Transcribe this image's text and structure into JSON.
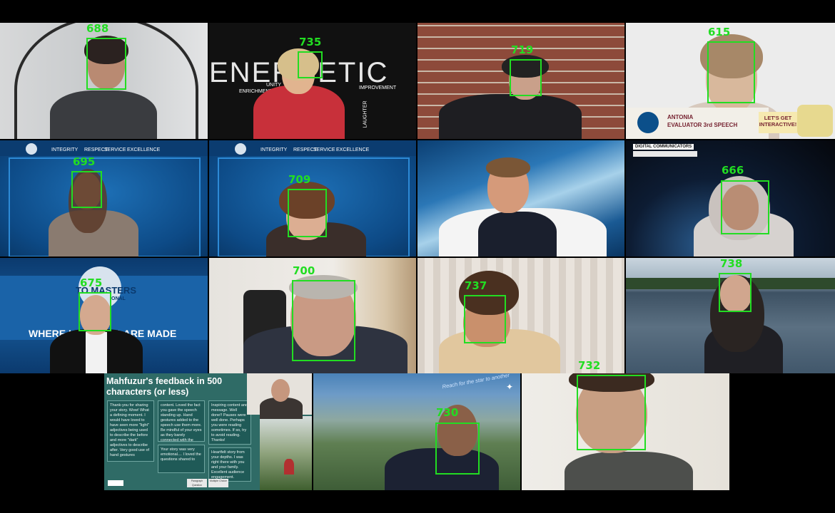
{
  "faces": [
    {
      "id": "688",
      "label": "688"
    },
    {
      "id": "735",
      "label": "735"
    },
    {
      "id": "719",
      "label": "719"
    },
    {
      "id": "615",
      "label": "615"
    },
    {
      "id": "695",
      "label": "695"
    },
    {
      "id": "709",
      "label": "709"
    },
    {
      "id": "666",
      "label": "666"
    },
    {
      "id": "675",
      "label": "675"
    },
    {
      "id": "700",
      "label": "700"
    },
    {
      "id": "737",
      "label": "737"
    },
    {
      "id": "738",
      "label": "738"
    },
    {
      "id": "730",
      "label": "730"
    },
    {
      "id": "732",
      "label": "732"
    }
  ],
  "backgrounds": {
    "energetic": "ENERGETIC",
    "energetic_words": [
      "ENRICHMENTS",
      "UNITY",
      "LAUGHTER",
      "IMPROVEMENT"
    ],
    "toastmasters_values": [
      "INTEGRITY",
      "RESPECT",
      "SERVICE",
      "EXCELLENCE"
    ],
    "antonia_name": "ANTONIA",
    "antonia_role": "EVALUATOR 3rd SPEECH",
    "lets_get": "LET'S GET",
    "interactive": "INTERACTIVE!",
    "digital_communicators": "DIGITAL COMMUNICATORS",
    "leaders_made_left": "WHERE L",
    "leaders_made_right": "S ARE MADE",
    "toastmasters_logo_text": "TO  MASTERS",
    "toastmasters_intl": "ONAL",
    "starry_text": "Reach for the star to another"
  },
  "feedback": {
    "title": "Mahfuzur's feedback in 500 characters (or less)",
    "cards": [
      "Thank-you for sharing your story. Wow! What a defining moment. I would have loved to have seen more \"light\" adjectives being used to describe the before and more \"dark\" adjectives to describe after. Very good use of hand gestures",
      "content. Loved the fact you gave the speech standing up. Hand gestures added to the speech use them more. Be mindful of your eyes as they barely connected with the camera. Also your voice tone felt monotonous.",
      "Your story was very emotional.... I loved the questions shared to",
      "Inspiring content and message. Well done!! Pauses were well done. Perhaps you were reading sometimes. If so, try to avoid reading. Thanks!",
      "Heartfelt story from your depths. I was right there with you and your family. Excellent audience engagement. Excellent"
    ],
    "buttons": [
      "Paragraph Question",
      "Multiple Choice",
      ""
    ]
  },
  "colors": {
    "face_box": "#22dd22",
    "toastmasters_blue": "#0b4f8a",
    "feedback_green": "#2f6b66"
  }
}
